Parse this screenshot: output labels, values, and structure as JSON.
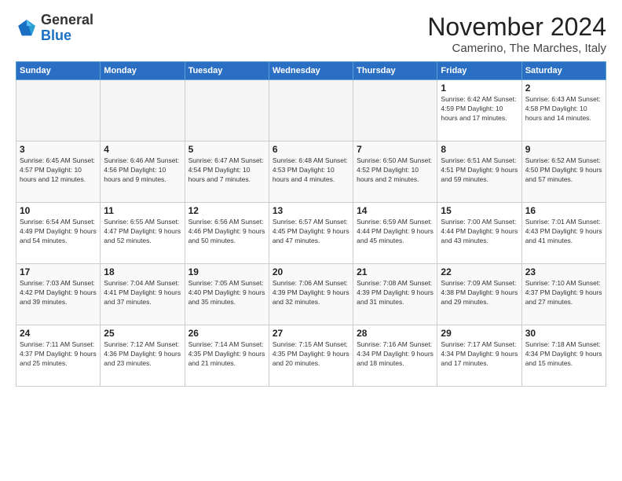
{
  "header": {
    "logo_general": "General",
    "logo_blue": "Blue",
    "month_title": "November 2024",
    "subtitle": "Camerino, The Marches, Italy"
  },
  "weekdays": [
    "Sunday",
    "Monday",
    "Tuesday",
    "Wednesday",
    "Thursday",
    "Friday",
    "Saturday"
  ],
  "weeks": [
    [
      {
        "day": "",
        "info": ""
      },
      {
        "day": "",
        "info": ""
      },
      {
        "day": "",
        "info": ""
      },
      {
        "day": "",
        "info": ""
      },
      {
        "day": "",
        "info": ""
      },
      {
        "day": "1",
        "info": "Sunrise: 6:42 AM\nSunset: 4:59 PM\nDaylight: 10 hours and 17 minutes."
      },
      {
        "day": "2",
        "info": "Sunrise: 6:43 AM\nSunset: 4:58 PM\nDaylight: 10 hours and 14 minutes."
      }
    ],
    [
      {
        "day": "3",
        "info": "Sunrise: 6:45 AM\nSunset: 4:57 PM\nDaylight: 10 hours and 12 minutes."
      },
      {
        "day": "4",
        "info": "Sunrise: 6:46 AM\nSunset: 4:56 PM\nDaylight: 10 hours and 9 minutes."
      },
      {
        "day": "5",
        "info": "Sunrise: 6:47 AM\nSunset: 4:54 PM\nDaylight: 10 hours and 7 minutes."
      },
      {
        "day": "6",
        "info": "Sunrise: 6:48 AM\nSunset: 4:53 PM\nDaylight: 10 hours and 4 minutes."
      },
      {
        "day": "7",
        "info": "Sunrise: 6:50 AM\nSunset: 4:52 PM\nDaylight: 10 hours and 2 minutes."
      },
      {
        "day": "8",
        "info": "Sunrise: 6:51 AM\nSunset: 4:51 PM\nDaylight: 9 hours and 59 minutes."
      },
      {
        "day": "9",
        "info": "Sunrise: 6:52 AM\nSunset: 4:50 PM\nDaylight: 9 hours and 57 minutes."
      }
    ],
    [
      {
        "day": "10",
        "info": "Sunrise: 6:54 AM\nSunset: 4:49 PM\nDaylight: 9 hours and 54 minutes."
      },
      {
        "day": "11",
        "info": "Sunrise: 6:55 AM\nSunset: 4:47 PM\nDaylight: 9 hours and 52 minutes."
      },
      {
        "day": "12",
        "info": "Sunrise: 6:56 AM\nSunset: 4:46 PM\nDaylight: 9 hours and 50 minutes."
      },
      {
        "day": "13",
        "info": "Sunrise: 6:57 AM\nSunset: 4:45 PM\nDaylight: 9 hours and 47 minutes."
      },
      {
        "day": "14",
        "info": "Sunrise: 6:59 AM\nSunset: 4:44 PM\nDaylight: 9 hours and 45 minutes."
      },
      {
        "day": "15",
        "info": "Sunrise: 7:00 AM\nSunset: 4:44 PM\nDaylight: 9 hours and 43 minutes."
      },
      {
        "day": "16",
        "info": "Sunrise: 7:01 AM\nSunset: 4:43 PM\nDaylight: 9 hours and 41 minutes."
      }
    ],
    [
      {
        "day": "17",
        "info": "Sunrise: 7:03 AM\nSunset: 4:42 PM\nDaylight: 9 hours and 39 minutes."
      },
      {
        "day": "18",
        "info": "Sunrise: 7:04 AM\nSunset: 4:41 PM\nDaylight: 9 hours and 37 minutes."
      },
      {
        "day": "19",
        "info": "Sunrise: 7:05 AM\nSunset: 4:40 PM\nDaylight: 9 hours and 35 minutes."
      },
      {
        "day": "20",
        "info": "Sunrise: 7:06 AM\nSunset: 4:39 PM\nDaylight: 9 hours and 32 minutes."
      },
      {
        "day": "21",
        "info": "Sunrise: 7:08 AM\nSunset: 4:39 PM\nDaylight: 9 hours and 31 minutes."
      },
      {
        "day": "22",
        "info": "Sunrise: 7:09 AM\nSunset: 4:38 PM\nDaylight: 9 hours and 29 minutes."
      },
      {
        "day": "23",
        "info": "Sunrise: 7:10 AM\nSunset: 4:37 PM\nDaylight: 9 hours and 27 minutes."
      }
    ],
    [
      {
        "day": "24",
        "info": "Sunrise: 7:11 AM\nSunset: 4:37 PM\nDaylight: 9 hours and 25 minutes."
      },
      {
        "day": "25",
        "info": "Sunrise: 7:12 AM\nSunset: 4:36 PM\nDaylight: 9 hours and 23 minutes."
      },
      {
        "day": "26",
        "info": "Sunrise: 7:14 AM\nSunset: 4:35 PM\nDaylight: 9 hours and 21 minutes."
      },
      {
        "day": "27",
        "info": "Sunrise: 7:15 AM\nSunset: 4:35 PM\nDaylight: 9 hours and 20 minutes."
      },
      {
        "day": "28",
        "info": "Sunrise: 7:16 AM\nSunset: 4:34 PM\nDaylight: 9 hours and 18 minutes."
      },
      {
        "day": "29",
        "info": "Sunrise: 7:17 AM\nSunset: 4:34 PM\nDaylight: 9 hours and 17 minutes."
      },
      {
        "day": "30",
        "info": "Sunrise: 7:18 AM\nSunset: 4:34 PM\nDaylight: 9 hours and 15 minutes."
      }
    ]
  ]
}
